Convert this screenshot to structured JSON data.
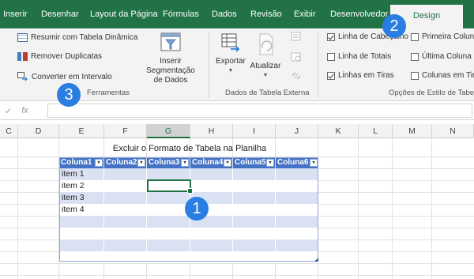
{
  "tabs": [
    {
      "label": "Inserir"
    },
    {
      "label": "Desenhar"
    },
    {
      "label": "Layout da Página"
    },
    {
      "label": "Fórmulas"
    },
    {
      "label": "Dados"
    },
    {
      "label": "Revisão"
    },
    {
      "label": "Exibir"
    },
    {
      "label": "Desenvolvedor"
    },
    {
      "label": "Design",
      "active": true
    }
  ],
  "ribbon": {
    "tools": {
      "summarize_label": "Resumir com Tabela Dinâmica",
      "remove_dup_label": "Remover Duplicatas",
      "convert_label": "Converter em Intervalo",
      "slicer_label_1": "Inserir Segmentação",
      "slicer_label_2": "de Dados",
      "group_label": "Ferramentas"
    },
    "external": {
      "export_label": "Exportar",
      "refresh_label": "Atualizar",
      "group_label": "Dados de Tabela Externa"
    },
    "style_options": {
      "header_row": {
        "label": "Linha de Cabeçalho",
        "checked": true
      },
      "total_row": {
        "label": "Linha de Totais",
        "checked": false
      },
      "banded_rows": {
        "label": "Linhas em Tiras",
        "checked": true
      },
      "first_column": {
        "label": "Primeira Coluna",
        "checked": false
      },
      "last_column": {
        "label": "Última Coluna",
        "checked": false
      },
      "banded_columns": {
        "label": "Colunas em Tiras",
        "checked": false
      },
      "group_label": "Opções de Estilo de Tabela"
    }
  },
  "formula_bar": {
    "check_symbol": "✓",
    "fx_symbol": "fx",
    "value": ""
  },
  "columns": [
    {
      "label": "C"
    },
    {
      "label": "D"
    },
    {
      "label": "E"
    },
    {
      "label": "F"
    },
    {
      "label": "G",
      "selected": true
    },
    {
      "label": "H"
    },
    {
      "label": "I"
    },
    {
      "label": "J"
    },
    {
      "label": "K"
    },
    {
      "label": "L"
    },
    {
      "label": "M"
    },
    {
      "label": "N"
    }
  ],
  "sheet": {
    "title": "Excluir o Formato de Tabela na Planilha",
    "table_headers": [
      "Coluna1",
      "Coluna2",
      "Coluna3",
      "Coluna4",
      "Coluna5",
      "Coluna6"
    ],
    "filter_glyph": "▾",
    "rows": [
      "item 1",
      "item 2",
      "item 3",
      "item 4"
    ]
  },
  "callouts": [
    "1",
    "2",
    "3"
  ],
  "colors": {
    "excel_green": "#217346",
    "table_header_blue": "#4472c4",
    "band_light_blue": "#d9e1f2",
    "callout_blue": "#2a7de1"
  }
}
